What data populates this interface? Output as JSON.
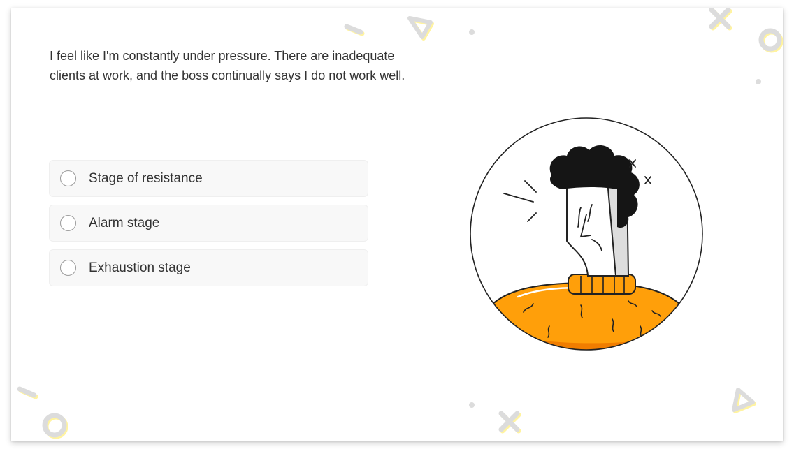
{
  "question": {
    "text": "I feel like I'm constantly under pressure. There are inadequate clients at work, and the boss continually says I do not work well."
  },
  "options": [
    {
      "label": "Stage of resistance",
      "selected": false
    },
    {
      "label": "Alarm stage",
      "selected": false
    },
    {
      "label": "Exhaustion stage",
      "selected": false
    }
  ],
  "illustration": {
    "subject": "stressed-person-icon",
    "colors": {
      "sweater": "#ff9f0a",
      "sweater_dark": "#f07d00",
      "hair": "#151515",
      "outline": "#222222"
    }
  },
  "decorations": {
    "color": "#dcdcdc",
    "shadow_color": "#fff3a0",
    "shapes": [
      "triangle",
      "cross",
      "ring",
      "dash",
      "dot"
    ]
  }
}
